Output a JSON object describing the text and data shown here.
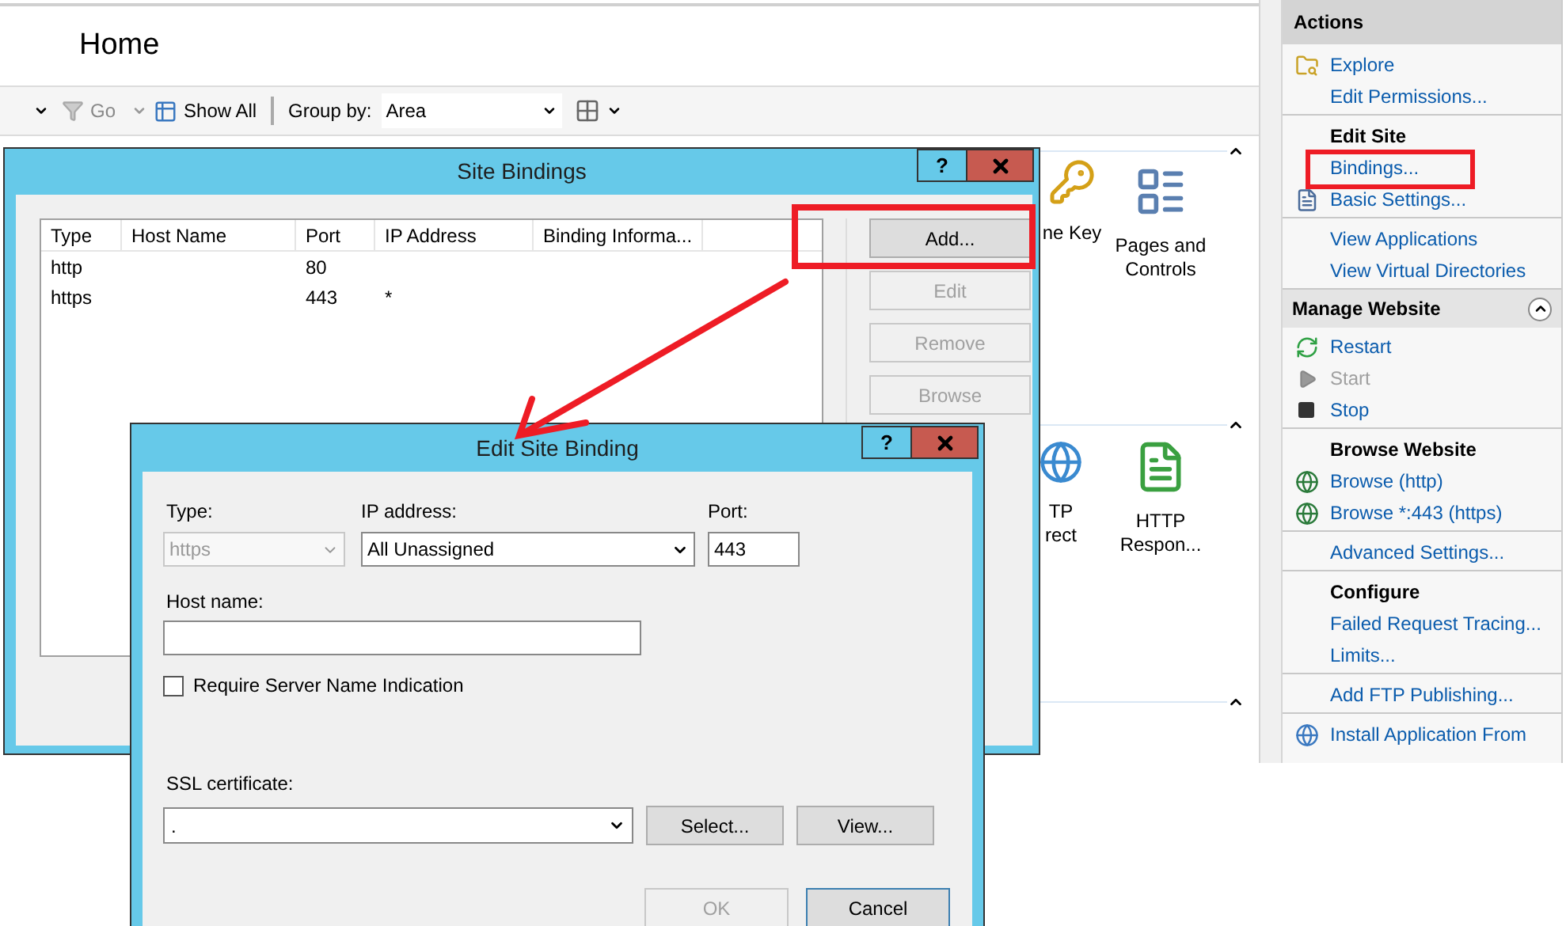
{
  "window": {
    "title": "Home"
  },
  "toolbar": {
    "go": "Go",
    "show_all": "Show All",
    "group_by_label": "Group by:",
    "group_by_value": "Area"
  },
  "features": [
    {
      "label": "ne Key",
      "kind": "key"
    },
    {
      "label": "Pages and Controls",
      "kind": "pages"
    },
    {
      "label": "TP rect",
      "kind": "redirect"
    },
    {
      "label": "HTTP Respon...",
      "kind": "response"
    }
  ],
  "actions": {
    "title": "Actions",
    "sections": [
      {
        "kind": "plain",
        "items": [
          {
            "label": "Explore",
            "kind": "explore",
            "disabled": false
          },
          {
            "label": "Edit Permissions...",
            "kind": "link",
            "disabled": false
          }
        ]
      },
      {
        "kind": "plain",
        "heading": "Edit Site",
        "items": [
          {
            "label": "Bindings...",
            "kind": "link",
            "disabled": false
          },
          {
            "label": "Basic Settings...",
            "kind": "settings",
            "disabled": false
          }
        ]
      },
      {
        "kind": "plain",
        "items": [
          {
            "label": "View Applications",
            "kind": "link",
            "disabled": false
          },
          {
            "label": "View Virtual Directories",
            "kind": "link",
            "disabled": false
          }
        ]
      },
      {
        "kind": "band",
        "heading": "Manage Website",
        "items": [
          {
            "label": "Restart",
            "kind": "restart",
            "disabled": false
          },
          {
            "label": "Start",
            "kind": "start",
            "disabled": true
          },
          {
            "label": "Stop",
            "kind": "stop",
            "disabled": false
          }
        ]
      },
      {
        "kind": "plain",
        "heading": "Browse Website",
        "items": [
          {
            "label": "Browse (http)",
            "kind": "browse",
            "disabled": false
          },
          {
            "label": "Browse *:443 (https)",
            "kind": "browse",
            "disabled": false
          }
        ]
      },
      {
        "kind": "plain",
        "items": [
          {
            "label": "Advanced Settings...",
            "kind": "link",
            "disabled": false
          }
        ]
      },
      {
        "kind": "plain",
        "heading": "Configure",
        "items": [
          {
            "label": "Failed Request Tracing...",
            "kind": "link",
            "disabled": false
          },
          {
            "label": "Limits...",
            "kind": "link",
            "disabled": false
          }
        ]
      },
      {
        "kind": "plain",
        "items": [
          {
            "label": "Add FTP Publishing...",
            "kind": "link",
            "disabled": false
          }
        ]
      },
      {
        "kind": "plain",
        "items": [
          {
            "label": "Install Application From",
            "kind": "install",
            "disabled": false
          }
        ]
      }
    ]
  },
  "site_bindings": {
    "title": "Site Bindings",
    "help": "?",
    "columns": [
      "Type",
      "Host Name",
      "Port",
      "IP Address",
      "Binding Informa..."
    ],
    "rows": [
      {
        "type": "http",
        "port": "80"
      },
      {
        "type": "https",
        "port": "443",
        "ip_address": "*"
      }
    ],
    "buttons": [
      {
        "label": "Add...",
        "disabled": false
      },
      {
        "label": "Edit",
        "disabled": true
      },
      {
        "label": "Remove",
        "disabled": true
      },
      {
        "label": "Browse",
        "disabled": true
      }
    ]
  },
  "edit_binding": {
    "title": "Edit Site Binding",
    "help": "?",
    "type": {
      "label": "Type:",
      "value": "https",
      "disabled": true
    },
    "ip_address": {
      "label": "IP address:",
      "value": "All Unassigned"
    },
    "port": {
      "label": "Port:",
      "value": "443"
    },
    "host_name": {
      "label": "Host name:"
    },
    "sni": {
      "label": "Require Server Name Indication",
      "checked": false
    },
    "ssl_certificate": {
      "label": "SSL certificate:",
      "value": "."
    },
    "cert_buttons": [
      {
        "label": "Select...",
        "disabled": false
      },
      {
        "label": "View...",
        "disabled": false
      }
    ],
    "buttons": [
      {
        "label": "OK",
        "disabled": true,
        "default": false
      },
      {
        "label": "Cancel",
        "disabled": false,
        "default": true
      }
    ]
  }
}
